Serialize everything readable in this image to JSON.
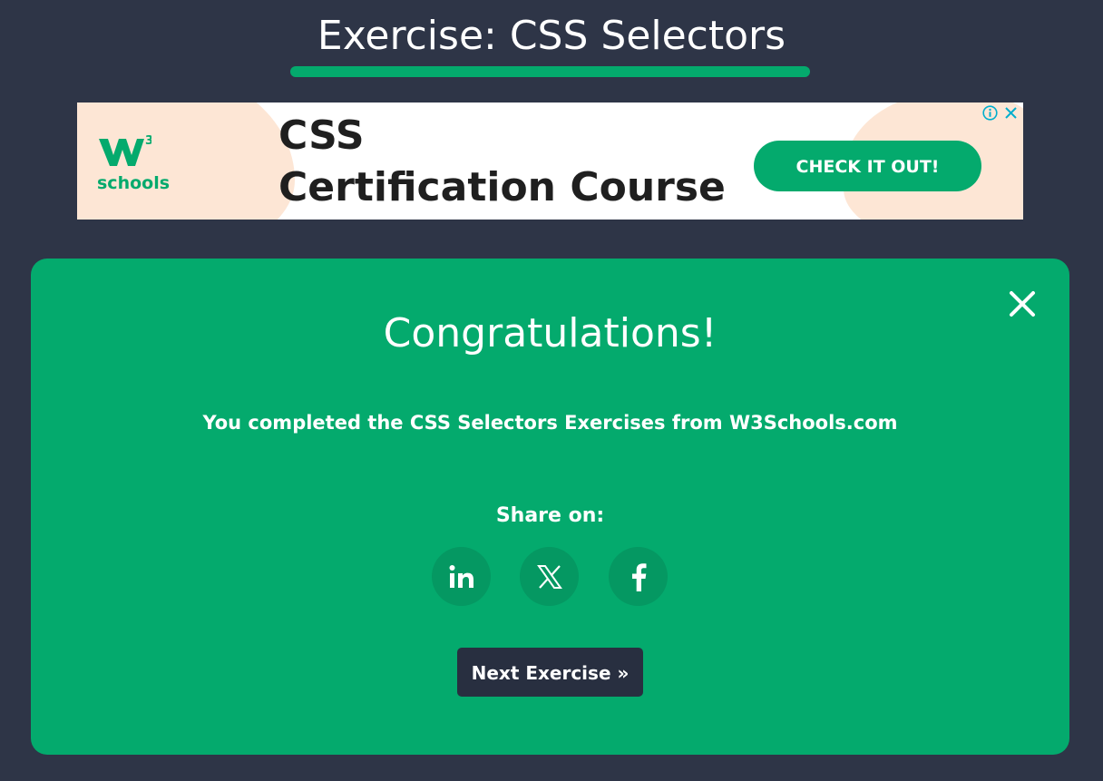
{
  "page": {
    "title": "Exercise: CSS Selectors"
  },
  "ad": {
    "logo_sup": "3",
    "logo_text": "schools",
    "headline_line1": "CSS",
    "headline_line2": "Certification Course",
    "cta_label": "CHECK IT OUT!",
    "icons": [
      "info-icon",
      "close-icon"
    ]
  },
  "modal": {
    "heading": "Congratulations!",
    "message": "You completed the CSS Selectors Exercises from W3Schools.com",
    "share_label": "Share on:",
    "share_buttons": [
      {
        "name": "linkedin",
        "icon": "linkedin-icon"
      },
      {
        "name": "x",
        "icon": "x-icon"
      },
      {
        "name": "facebook",
        "icon": "facebook-icon"
      }
    ],
    "next_label": "Next Exercise »",
    "close_icon": "close-icon"
  },
  "colors": {
    "background": "#2e3547",
    "accent": "#04aa6d",
    "accent_dark": "#059862",
    "button_dark": "#282f40",
    "ad_peach": "#fde6d5",
    "ad_info": "#00aecd"
  }
}
